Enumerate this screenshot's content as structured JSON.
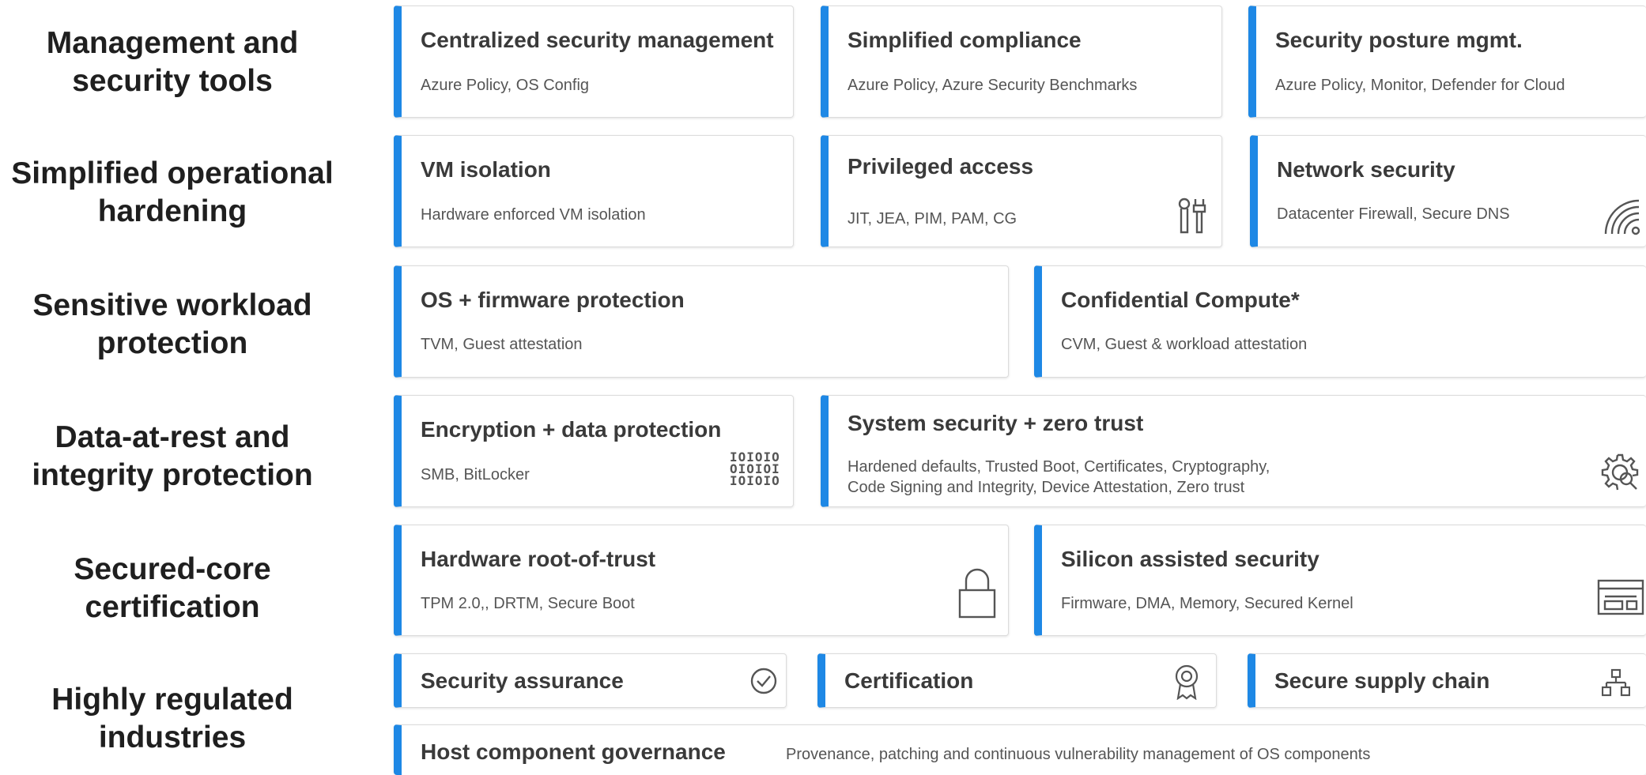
{
  "row_labels": {
    "r1": [
      "Management and",
      "security tools"
    ],
    "r2": [
      "Simplified operational",
      "hardening"
    ],
    "r3": [
      "Sensitive workload",
      "protection"
    ],
    "r4": [
      "Data-at-rest and",
      "integrity protection"
    ],
    "r5": [
      "Secured-core",
      "certification"
    ],
    "r6": [
      "Highly regulated",
      "industries"
    ]
  },
  "cards": {
    "central": {
      "title": "Centralized security management",
      "sub": "Azure Policy, OS Config"
    },
    "compliance": {
      "title": "Simplified compliance",
      "sub": "Azure Policy, Azure Security Benchmarks"
    },
    "posture": {
      "title": "Security posture mgmt.",
      "sub": "Azure Policy, Monitor, Defender for Cloud"
    },
    "vm": {
      "title": "VM isolation",
      "sub": "Hardware enforced VM isolation"
    },
    "priv": {
      "title": "Privileged access",
      "sub": "JIT, JEA, PIM, PAM, CG"
    },
    "net": {
      "title": "Network security",
      "sub": "Datacenter Firewall, Secure DNS"
    },
    "osfw": {
      "title": "OS + firmware protection",
      "sub": "TVM, Guest attestation"
    },
    "conf": {
      "title": "Confidential Compute*",
      "sub": "CVM, Guest & workload attestation"
    },
    "enc": {
      "title": "Encryption + data protection",
      "sub": "SMB, BitLocker"
    },
    "sys": {
      "title": "System security + zero trust",
      "sub_line1": "Hardened defaults, Trusted Boot, Certificates, Cryptography,",
      "sub_line2": "Code Signing and Integrity, Device Attestation, Zero trust"
    },
    "hw": {
      "title": "Hardware root-of-trust",
      "sub": "TPM 2.0,, DRTM, Secure Boot"
    },
    "silicon": {
      "title": "Silicon assisted security",
      "sub": "Firmware, DMA, Memory, Secured Kernel"
    },
    "assurance": {
      "title": "Security assurance"
    },
    "cert": {
      "title": "Certification"
    },
    "supply": {
      "title": "Secure supply chain"
    },
    "hcg": {
      "title": "Host component governance",
      "sub": "Provenance, patching and continuous vulnerability management of OS components"
    }
  },
  "icons": {
    "binary_lines": [
      "IOIOIO",
      "OIOIOI",
      "IOIOIO"
    ]
  },
  "colors": {
    "accent": "#1e88e5"
  }
}
